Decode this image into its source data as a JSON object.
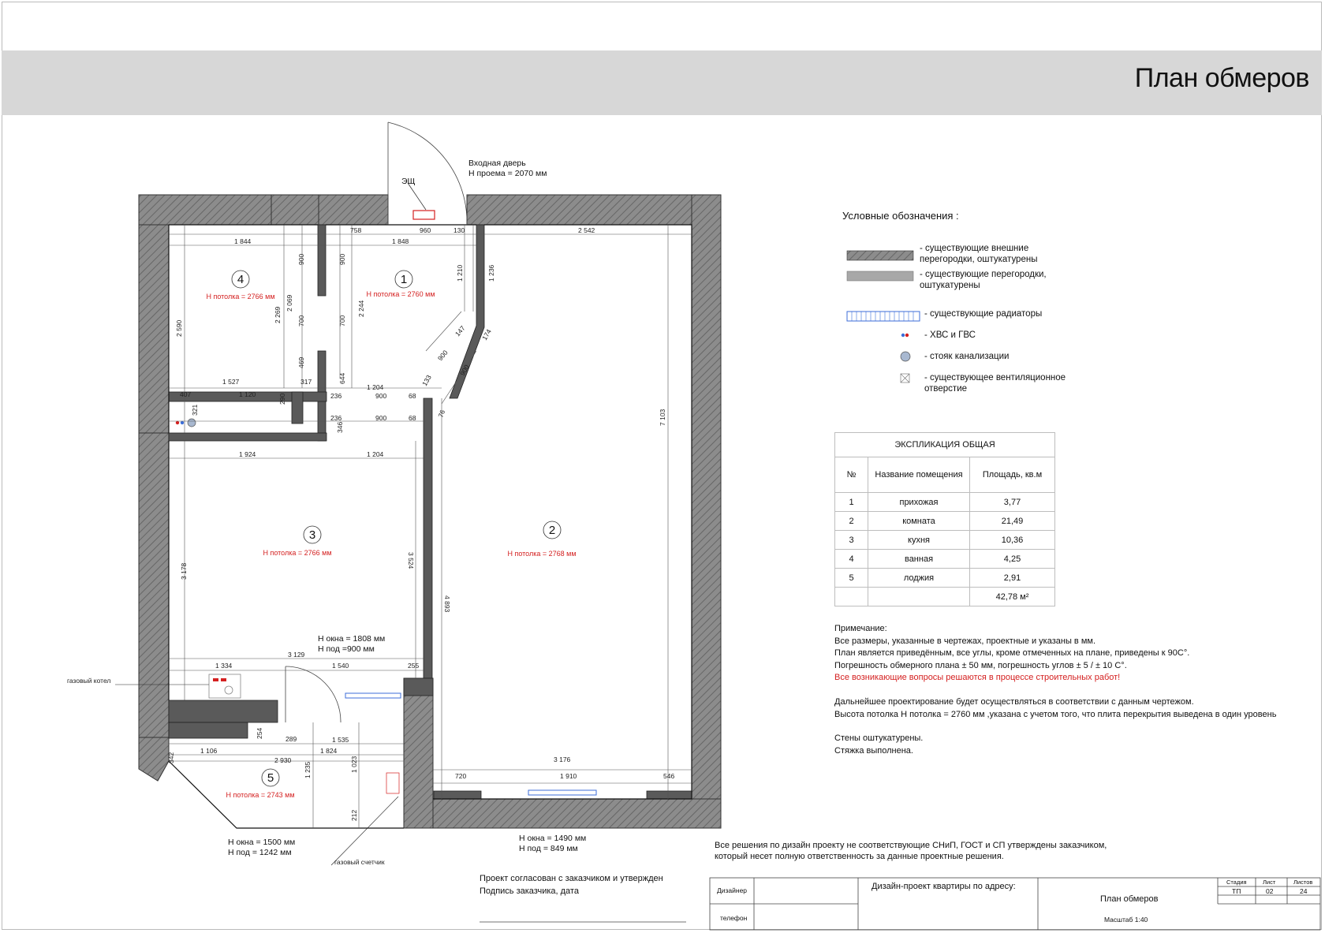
{
  "page_title": "План обмеров",
  "plan": {
    "entrance": {
      "line1": "Входная дверь",
      "line2": "Н проема = 2070 мм"
    },
    "panel": "ЭЩ",
    "rooms": [
      {
        "number": "1",
        "ceiling": "Н потолка = 2760 мм"
      },
      {
        "number": "2",
        "ceiling": "Н потолка = 2768 мм"
      },
      {
        "number": "3",
        "ceiling": "Н потолка = 2766 мм"
      },
      {
        "number": "4",
        "ceiling": "Н потолка = 2766 мм"
      },
      {
        "number": "5",
        "ceiling": "Н потолка = 2743 мм"
      }
    ],
    "windows": {
      "kitchen": {
        "h": "Н окна = 1808 мм",
        "sill": "Н под =900 мм"
      },
      "loggia": {
        "h": "Н окна = 1500 мм",
        "sill": "Н под = 1242 мм"
      },
      "room": {
        "h": "Н окна = 1490 мм",
        "sill": "Н под = 849 мм"
      }
    },
    "callouts": {
      "boiler": "газовый котел",
      "meter": "газовый счетчик"
    },
    "dimensions": {
      "d758": "758",
      "d960": "960",
      "d130": "130",
      "d2542": "2 542",
      "d1844": "1 844",
      "d1848": "1 848",
      "d900a": "900",
      "d900b": "900",
      "d1210": "1 210",
      "d1236": "1 236",
      "d2590": "2 590",
      "d2269": "2 269",
      "d2069": "2 069",
      "d700a": "700",
      "d700b": "700",
      "d2244": "2 244",
      "d469": "469",
      "d644": "644",
      "d147": "147",
      "d174": "174",
      "d900c": "900",
      "d900d": "900",
      "d133": "133",
      "d76": "76",
      "d7103": "7 103",
      "d1527": "1 527",
      "d317": "317",
      "d1204a": "1 204",
      "d407": "407",
      "d1120": "1 120",
      "d290": "290",
      "d236a": "236",
      "d900e": "900",
      "d68a": "68",
      "d321": "321",
      "d236b": "236",
      "d900f": "900",
      "d68b": "68",
      "d346": "346",
      "d1924": "1 924",
      "d1204b": "1 204",
      "d3178": "3 178",
      "d3524": "3 524",
      "d4893": "4 893",
      "d3129": "3 129",
      "d1334": "1 334",
      "d1540": "1 540",
      "d255": "255",
      "d254": "254",
      "d289": "289",
      "d1535": "1 535",
      "d1106": "1 106",
      "d1824": "1 824",
      "d342": "342",
      "d2930": "2 930",
      "d1023": "1 023",
      "d1235": "1 235",
      "d212": "212",
      "d3176": "3 176",
      "d720": "720",
      "d1910": "1 910",
      "d546": "546"
    }
  },
  "legend": {
    "title": "Условные обозначения :",
    "items": [
      {
        "icon": "hatched-wall-swatch",
        "text": "-  существующие внешние\n   перегородки,   оштукатурены"
      },
      {
        "icon": "partition-swatch",
        "text": "-  существующие перегородки,\n   оштукатурены"
      },
      {
        "icon": "radiator-icon",
        "text": "- существующие радиаторы"
      },
      {
        "icon": "water-pipes-icon",
        "text": "-  ХВС и ГВС"
      },
      {
        "icon": "sewer-riser-icon",
        "text": "- стояк канализации"
      },
      {
        "icon": "vent-opening-icon",
        "text": " - существующее вентиляционное\n   отверстие"
      }
    ]
  },
  "explication": {
    "title": "ЭКСПЛИКАЦИЯ ОБЩАЯ",
    "headers": [
      "№",
      "Название помещения",
      "Площадь, кв.м"
    ],
    "rows": [
      [
        "1",
        "прихожая",
        "3,77"
      ],
      [
        "2",
        "комната",
        "21,49"
      ],
      [
        "3",
        "кухня",
        "10,36"
      ],
      [
        "4",
        "ванная",
        "4,25"
      ],
      [
        "5",
        "лоджия",
        "2,91"
      ]
    ],
    "total": "42,78 м²"
  },
  "notes": {
    "lines": [
      "Примечание:",
      "Все размеры, указанные в чертежах, проектные и указаны в мм.",
      "План является приведённым, все углы, кроме отмеченных на плане, приведены к 90С°.",
      "Погрешность обмерного плана  ± 50 мм, погрешность углов ± 5 /  ± 10 С°."
    ],
    "warning": "Все возникающие вопросы решаются в процессе строительных работ!",
    "lines2": [
      "Дальнейшее проектирование будет осуществляться в соответствии с данным чертежом.",
      "Высота потолка Н потолка = 2760 мм ,указана с учетом того, что плита перекрытия выведена в один уровень"
    ],
    "lines3": [
      "Стены оштукатурены.",
      "Стяжка выполнена."
    ]
  },
  "footer": {
    "approval": {
      "line1": "Проект согласован с заказчиком и утвержден",
      "line2": "Подпись заказчика, дата"
    },
    "disclaimer": {
      "line1": "Все решения по дизайн проекту не соответствующие СНиП, ГОСТ и СП утверждены заказчиком,",
      "line2": "который несет полную ответственность за данные проектные решения."
    },
    "stamp": {
      "designer": "Дизайнер",
      "phone": "телефон",
      "project": "Дизайн-проект квартиры по адресу:",
      "sheet_title": "План обмеров",
      "scale": "Масштаб 1:40",
      "stage_h": "Стадия",
      "sheet_h": "Лист",
      "sheets_h": "Листов",
      "stage": "ТП",
      "sheet": "02",
      "sheets": "24"
    }
  },
  "colors": {
    "wall": "#7d7d7d",
    "partition": "#5a5a5a",
    "hatch": "#a3a3a3",
    "annotation_red": "#d42020",
    "header_band": "#d7d7d7",
    "radiator": "#3c6ed8"
  }
}
